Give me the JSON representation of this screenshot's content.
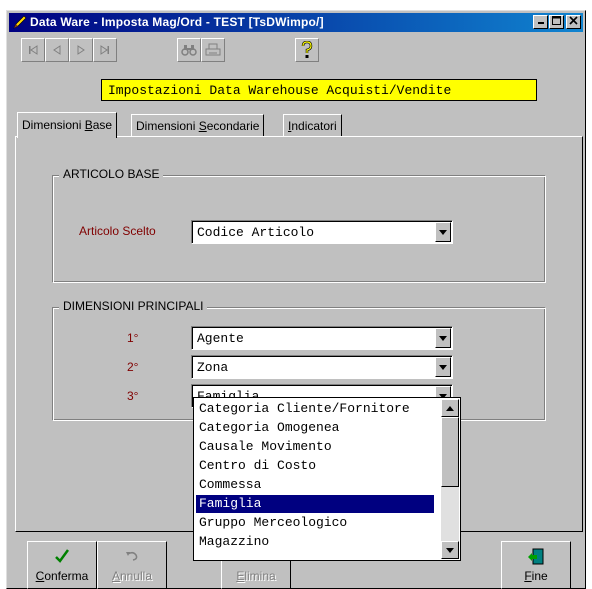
{
  "window": {
    "title": "Data Ware - Imposta Mag/Ord - TEST [TsDWimpo/]",
    "controls": [
      "minimize",
      "maximize",
      "close"
    ]
  },
  "toolbar": {
    "buttons": [
      {
        "name": "first-record",
        "icon": "first-icon",
        "enabled": false
      },
      {
        "name": "previous-record",
        "icon": "previous-icon",
        "enabled": false
      },
      {
        "name": "next-record",
        "icon": "next-icon",
        "enabled": false
      },
      {
        "name": "last-record",
        "icon": "last-icon",
        "enabled": false
      },
      {
        "name": "find",
        "icon": "binoculars-icon",
        "enabled": false
      },
      {
        "name": "print",
        "icon": "printer-icon",
        "enabled": false
      },
      {
        "name": "help",
        "icon": "question-mark-icon",
        "enabled": true
      }
    ]
  },
  "heading": "Impostazioni Data Warehouse Acquisti/Vendite",
  "tabs": [
    {
      "label": "Dimensioni Base",
      "shortcut": "B",
      "active": true
    },
    {
      "label": "Dimensioni Secondarie",
      "shortcut": "S",
      "active": false
    },
    {
      "label": "Indicatori",
      "shortcut": "I",
      "active": false
    }
  ],
  "articolo_base": {
    "title": "ARTICOLO BASE",
    "label": "Articolo Scelto",
    "value": "Codice Articolo"
  },
  "dimensioni_principali": {
    "title": "DIMENSIONI PRINCIPALI",
    "rows": [
      {
        "label": "1°",
        "value": "Agente"
      },
      {
        "label": "2°",
        "value": "Zona"
      },
      {
        "label": "3°",
        "value": "Famiglia"
      }
    ]
  },
  "dropdown": {
    "items": [
      "Categoria Cliente/Fornitore",
      "Categoria Omogenea",
      "Causale Movimento",
      "Centro di Costo",
      "Commessa",
      "Famiglia",
      "Gruppo Merceologico",
      "Magazzino"
    ],
    "selected": "Famiglia"
  },
  "actions": {
    "conferma": {
      "label": "Conferma",
      "icon": "checkmark-icon",
      "enabled": true
    },
    "annulla": {
      "label": "Annulla",
      "icon": "undo-icon",
      "enabled": false
    },
    "elimina": {
      "label": "Elimina",
      "icon": "delete-icon",
      "enabled": false
    },
    "fine": {
      "label": "Fine",
      "icon": "exit-door-icon",
      "enabled": true
    }
  },
  "colors": {
    "titlebar_start": "#000080",
    "titlebar_end": "#1084d0",
    "heading_background": "#ffff00",
    "field_label": "#800000",
    "selection": "#000080",
    "window_face": "#c0c0c0",
    "confirm_icon": "#008000"
  }
}
